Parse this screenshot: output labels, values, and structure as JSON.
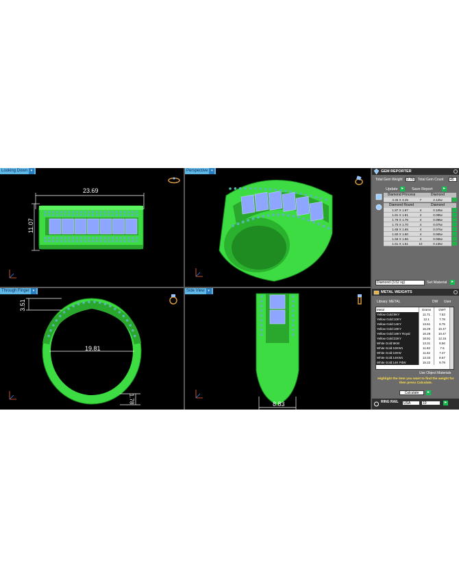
{
  "viewports": {
    "top_left": {
      "label": "Looking Down",
      "width_dim": "23.69",
      "height_dim": "11.07"
    },
    "top_right": {
      "label": "Perspective"
    },
    "bottom_left": {
      "label": "Through Finger",
      "top_dim": "3.51",
      "diameter_dim": "19.81",
      "thickness_dim": "1.78"
    },
    "bottom_right": {
      "label": "Side View",
      "width_dim": "8.83"
    }
  },
  "gem_reporter": {
    "title": "GEM REPORTER",
    "total_weight_label": "Total Gem Weight",
    "total_weight_value": "2.78",
    "total_count_label": "Total Gem Count",
    "total_count_value": "45",
    "update_label": "Update",
    "save_report_label": "Save Report",
    "groups": [
      {
        "shape": "Diamond Princess",
        "material": "Diamond",
        "rows": [
          {
            "size": "3.45 X 3.45",
            "count": "7",
            "weight": "2.12tw"
          }
        ]
      },
      {
        "shape": "Diamond Round",
        "material": "Diamond",
        "rows": [
          {
            "size": "1.87 X 1.87",
            "count": "4",
            "weight": "0.10tw"
          },
          {
            "size": "1.81 X 1.81",
            "count": "4",
            "weight": "0.09tw"
          },
          {
            "size": "1.76 X 1.76",
            "count": "4",
            "weight": "0.08tw"
          },
          {
            "size": "1.70 X 1.70",
            "count": "4",
            "weight": "0.07tw"
          },
          {
            "size": "1.65 X 1.65",
            "count": "4",
            "weight": "0.07tw"
          },
          {
            "size": "1.60 X 1.60",
            "count": "4",
            "weight": "0.06tw"
          },
          {
            "size": "1.56 X 1.56",
            "count": "4",
            "weight": "0.06tw"
          },
          {
            "size": "1.51 X 1.51",
            "count": "10",
            "weight": "0.13tw"
          }
        ]
      }
    ],
    "material_select": "Diamond    (3.52 sg)",
    "set_material_label": "Set Material"
  },
  "metal_weights": {
    "title": "METAL WEIGHTS",
    "library_label": "Library: METAL",
    "dw_label": "DW",
    "user_label": "User",
    "headers": [
      "Metal",
      "Grams",
      "DWT"
    ],
    "rows": [
      [
        "Yellow Gold:9KY",
        "11.71",
        "7.53"
      ],
      [
        "Yellow Gold:10KY",
        "12.1",
        "7.78"
      ],
      [
        "Yellow Gold:14KY",
        "13.61",
        "8.75"
      ],
      [
        "Yellow Gold:18KY",
        "16.29",
        "10.47"
      ],
      [
        "Yellow Gold:18KY Royal",
        "16.29",
        "10.47"
      ],
      [
        "Yellow Gold:22KY",
        "18.91",
        "12.16"
      ],
      [
        "White Gold:9KW",
        "13.31",
        "8.56"
      ],
      [
        "White Gold:10KW1",
        "11.82",
        "7.6"
      ],
      [
        "White Gold:10KW",
        "11.62",
        "7.47"
      ],
      [
        "White Gold:14KW1",
        "13.33",
        "8.57"
      ],
      [
        "White Gold:14K PdW",
        "15.22",
        "9.79"
      ]
    ],
    "use_object_label": "Use Object Materials",
    "hint": "Highlight the item you want to find the weight for then press Calculate.",
    "calculate_label": "Calculate"
  },
  "ring_rail": {
    "title": "RING RAIL",
    "region": "USA",
    "size": "10"
  }
}
